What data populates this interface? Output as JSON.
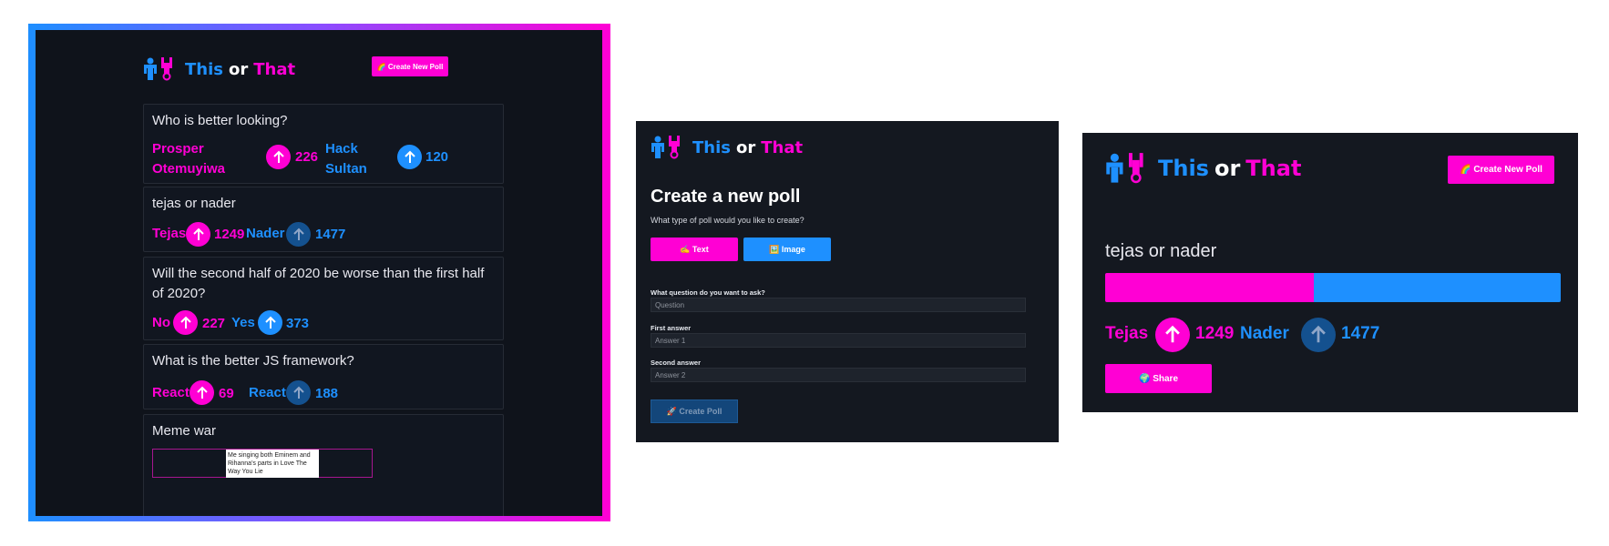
{
  "colors": {
    "pink": "#ff00d4",
    "blue": "#1e90ff",
    "background": "#141820"
  },
  "logo": {
    "this": "This",
    "or": "or",
    "that": "That"
  },
  "screen1": {
    "create_button": "🌈 Create New Poll",
    "polls": [
      {
        "question": "Who is better looking?",
        "a": "Prosper Otemuyiwa",
        "a_votes": "226",
        "b": "Hack Sultan",
        "b_votes": "120"
      },
      {
        "question": "tejas or nader",
        "a": "Tejas",
        "a_votes": "1249",
        "b": "Nader",
        "b_votes": "1477"
      },
      {
        "question": "Will the second half of 2020 be worse than the first half of 2020?",
        "a": "No",
        "a_votes": "227",
        "b": "Yes",
        "b_votes": "373"
      },
      {
        "question": "What is the better JS framework?",
        "a": "React",
        "a_votes": "69",
        "b": "React",
        "b_votes": "188"
      },
      {
        "question": "Meme war",
        "image_caption": "Me singing both Eminem and Rihanna's parts in Love The Way You Lie"
      }
    ]
  },
  "screen2": {
    "title": "Create a new poll",
    "subtitle": "What type of poll would you like to create?",
    "text_button": "✍️ Text",
    "image_button": "🖼️ Image",
    "question_label": "What question do you want to ask?",
    "question_placeholder": "Question",
    "first_label": "First answer",
    "first_placeholder": "Answer 1",
    "second_label": "Second answer",
    "second_placeholder": "Answer 2",
    "create_button": "🚀 Create Poll"
  },
  "screen3": {
    "create_button": "🌈 Create New Poll",
    "question": "tejas or nader",
    "a": "Tejas",
    "a_votes": "1249",
    "b": "Nader",
    "b_votes": "1477",
    "a_share": 0.458,
    "share_button": "🌍 Share"
  }
}
